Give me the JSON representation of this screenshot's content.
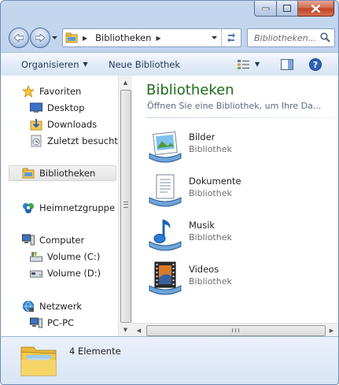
{
  "window": {
    "minimize_icon": "minimize-icon",
    "maximize_icon": "maximize-icon",
    "close_icon": "close-icon"
  },
  "address": {
    "breadcrumb": "Bibliotheken",
    "search_placeholder": "Bibliotheken..."
  },
  "toolbar": {
    "organize_label": "Organisieren",
    "new_library_label": "Neue Bibliothek",
    "views_icon": "views-icon",
    "preview_icon": "preview-pane-icon",
    "help_icon": "help-icon"
  },
  "nav": {
    "favorites": {
      "label": "Favoriten",
      "icon": "star-icon"
    },
    "favorites_items": [
      {
        "label": "Desktop",
        "icon": "desktop-icon"
      },
      {
        "label": "Downloads",
        "icon": "downloads-icon"
      },
      {
        "label": "Zuletzt besucht",
        "icon": "recent-places-icon"
      }
    ],
    "libraries": {
      "label": "Bibliotheken",
      "icon": "libraries-icon",
      "selected": true
    },
    "homegroup": {
      "label": "Heimnetzgruppe",
      "icon": "homegroup-icon"
    },
    "computer": {
      "label": "Computer",
      "icon": "computer-icon"
    },
    "computer_items": [
      {
        "label": "Volume (C:)",
        "icon": "system-drive-icon"
      },
      {
        "label": "Volume (D:)",
        "icon": "drive-icon"
      }
    ],
    "network": {
      "label": "Netzwerk",
      "icon": "network-icon"
    },
    "network_items": [
      {
        "label": "PC-PC",
        "icon": "pc-icon"
      }
    ]
  },
  "main": {
    "heading": "Bibliotheken",
    "subheading": "Öffnen Sie eine Bibliothek, um Ihre Da...",
    "libraries": [
      {
        "name": "Bilder",
        "type": "Bibliothek",
        "icon": "pictures-library-icon"
      },
      {
        "name": "Dokumente",
        "type": "Bibliothek",
        "icon": "documents-library-icon"
      },
      {
        "name": "Musik",
        "type": "Bibliothek",
        "icon": "music-library-icon"
      },
      {
        "name": "Videos",
        "type": "Bibliothek",
        "icon": "videos-library-icon"
      }
    ]
  },
  "status": {
    "count_text": "4 Elemente",
    "icon": "libraries-folder-icon"
  },
  "colors": {
    "heading_green": "#1e6d1c",
    "frame_blue": "#b3cbe8",
    "close_red": "#c24526"
  }
}
